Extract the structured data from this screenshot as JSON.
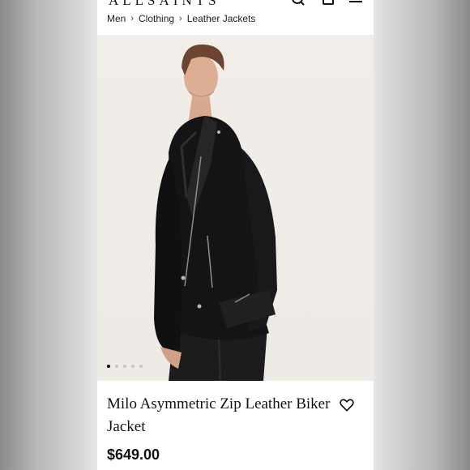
{
  "brand": {
    "name": "ALLSAINTS"
  },
  "icons": {
    "search": "search-icon",
    "bag": "shopping-bag-icon",
    "menu": "hamburger-menu-icon",
    "wishlist": "heart-icon"
  },
  "breadcrumb": {
    "items": [
      "Men",
      "Clothing",
      "Leather Jackets"
    ],
    "separator": "›"
  },
  "gallery": {
    "image_count": 5,
    "active_index": 0
  },
  "product": {
    "title": "Milo Asymmetric Zip Leather Biker Jacket",
    "price": "$649.00"
  }
}
